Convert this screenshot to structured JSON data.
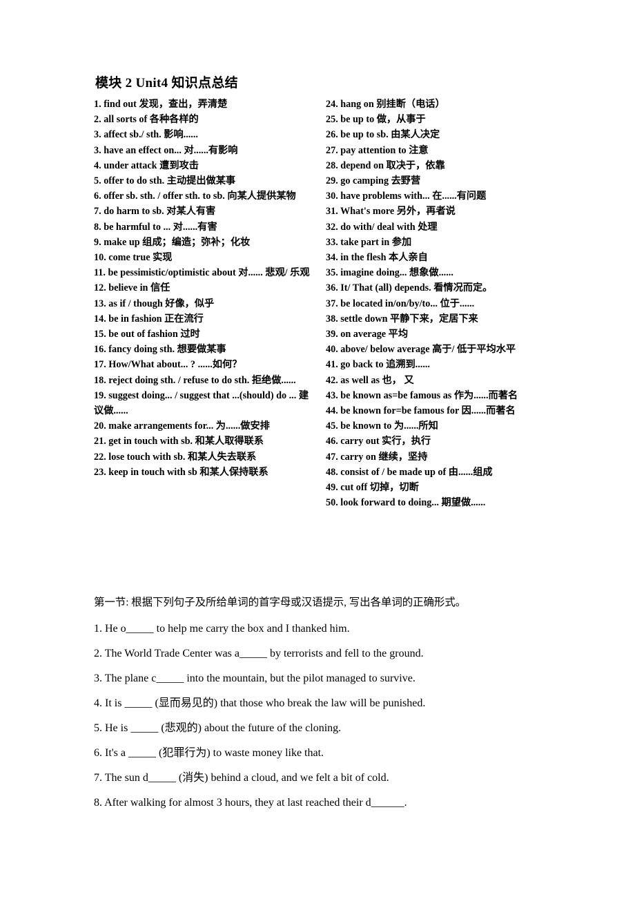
{
  "document": {
    "title": "模块 2 Unit4 知识点总结"
  },
  "vocabulary": {
    "left_column": [
      {
        "num": "1.",
        "en": "find out",
        "cn": "发现，查出，弄清楚"
      },
      {
        "num": "2.",
        "en": "all sorts of",
        "cn": "各种各样的"
      },
      {
        "num": "3.",
        "en": "affect sb./ sth.",
        "cn": "影响......"
      },
      {
        "num": "3.",
        "en": "have an effect on...",
        "cn": "对......有影响"
      },
      {
        "num": "4.",
        "en": "under attack",
        "cn": "遭到攻击"
      },
      {
        "num": "5.",
        "en": "offer to do sth.",
        "cn": "主动提出做某事"
      },
      {
        "num": "6.",
        "en": "offer sb. sth. / offer sth. to sb.",
        "cn": "向某人提供某物"
      },
      {
        "num": "7.",
        "en": "do harm to sb.",
        "cn": "对某人有害"
      },
      {
        "num": "8.",
        "en": "be harmful to ...",
        "cn": "对......有害"
      },
      {
        "num": "9.",
        "en": "make up",
        "cn": "组成；编造；弥补；化妆"
      },
      {
        "num": "10.",
        "en": "come true",
        "cn": "实现"
      },
      {
        "num": "11.",
        "en": "be pessimistic/optimistic about",
        "cn": "对...... 悲观/ 乐观"
      },
      {
        "num": "12.",
        "en": "believe in",
        "cn": "信任"
      },
      {
        "num": "13.",
        "en": "as if / though",
        "cn": "好像，似乎"
      },
      {
        "num": "14.",
        "en": "be in fashion",
        "cn": "正在流行"
      },
      {
        "num": "15.",
        "en": "be out of fashion",
        "cn": "过时"
      },
      {
        "num": "16.",
        "en": "fancy doing sth.",
        "cn": "想要做某事"
      },
      {
        "num": "17.",
        "en": "How/What about...  ?",
        "cn": "......如何？"
      },
      {
        "num": "18.",
        "en": "reject doing sth. / refuse to do sth.",
        "cn": "拒绝做......"
      },
      {
        "num": "19.",
        "en": "suggest doing... / suggest that ...(should) do ...",
        "cn": "建议做......"
      },
      {
        "num": "20.",
        "en": "make arrangements for...",
        "cn": "为......做安排"
      },
      {
        "num": "21.",
        "en": "get in touch with sb.",
        "cn": "和某人取得联系"
      },
      {
        "num": "22.",
        "en": "lose touch with sb.",
        "cn": "和某人失去联系"
      },
      {
        "num": "23.",
        "en": "keep in touch with sb",
        "cn": "和某人保持联系"
      }
    ],
    "right_column": [
      {
        "num": "24.",
        "en": "hang on",
        "cn": "别挂断（电话）"
      },
      {
        "num": "25.",
        "en": "be up to",
        "cn": "做，从事于"
      },
      {
        "num": "26.",
        "en": "be up to sb.",
        "cn": "由某人决定"
      },
      {
        "num": "27.",
        "en": "pay attention to",
        "cn": "注意"
      },
      {
        "num": "28.",
        "en": "depend on",
        "cn": "取决于，依靠"
      },
      {
        "num": "29.",
        "en": "go camping",
        "cn": "去野营"
      },
      {
        "num": "30.",
        "en": "have problems with...",
        "cn": "在......有问题"
      },
      {
        "num": "31.",
        "en": "What's more",
        "cn": "另外，再者说"
      },
      {
        "num": "32.",
        "en": "do with/ deal with",
        "cn": "处理"
      },
      {
        "num": "33.",
        "en": "take part in",
        "cn": "参加"
      },
      {
        "num": "34.",
        "en": "in the flesh",
        "cn": "本人亲自"
      },
      {
        "num": "35.",
        "en": "imagine doing...",
        "cn": "想象做......"
      },
      {
        "num": "36.",
        "en": "It/ That (all) depends.",
        "cn": "看情况而定。"
      },
      {
        "num": "37.",
        "en": "be located in/on/by/to...",
        "cn": "位于......"
      },
      {
        "num": "38.",
        "en": "settle down",
        "cn": "平静下来，定居下来"
      },
      {
        "num": "39.",
        "en": "on average",
        "cn": "平均"
      },
      {
        "num": "40.",
        "en": "above/ below average",
        "cn": "高于/ 低于平均水平"
      },
      {
        "num": "41.",
        "en": "go back to",
        "cn": "追溯到......"
      },
      {
        "num": "42.",
        "en": "as well as",
        "cn": "也， 又"
      },
      {
        "num": "43.",
        "en": "be known as=be famous as",
        "cn": "作为......而著名"
      },
      {
        "num": "44.",
        "en": "be known for=be famous for",
        "cn": "因......而著名"
      },
      {
        "num": "45.",
        "en": "be known to",
        "cn": "为......所知"
      },
      {
        "num": "46.",
        "en": "carry out",
        "cn": "实行，执行"
      },
      {
        "num": "47.",
        "en": "carry on",
        "cn": "继续，坚持"
      },
      {
        "num": "48.",
        "en": "consist of / be made up of",
        "cn": "由......组成"
      },
      {
        "num": "49.",
        "en": "cut off",
        "cn": "切掉，切断"
      },
      {
        "num": "50.",
        "en": "look forward to doing...",
        "cn": "期望做......"
      }
    ]
  },
  "exercises": {
    "heading": "第一节: 根据下列句子及所给单词的首字母或汉语提示, 写出各单词的正确形式。",
    "items": [
      "1. He o_____ to help me carry the box and I thanked him.",
      "2. The World Trade Center was a_____ by terrorists and fell to the ground.",
      "3. The plane c_____ into the mountain, but the pilot managed to survive.",
      "4. It is _____ (显而易见的) that those who break the law will be punished.",
      "5. He is _____ (悲观的) about the future of the cloning.",
      "6. It's a _____ (犯罪行为) to waste money like that.",
      "7. The sun d_____ (消失) behind a cloud, and we felt a bit of cold.",
      "8. After walking for almost 3 hours, they at last reached their d______."
    ]
  }
}
